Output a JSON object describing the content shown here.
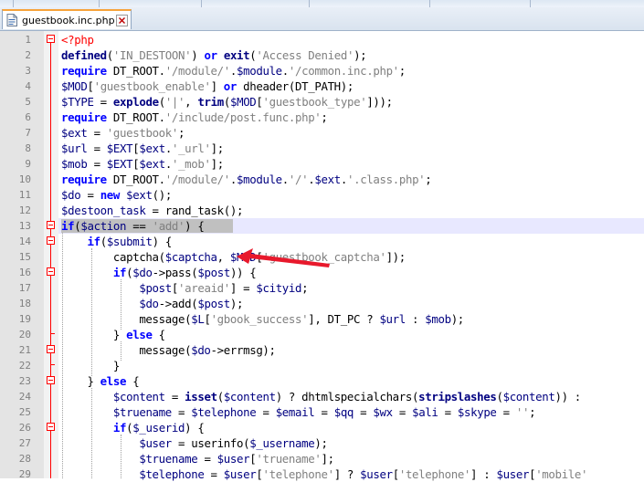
{
  "tab": {
    "filename": "guestbook.inc.php"
  },
  "editor": {
    "current_line": 13,
    "lines": [
      {
        "n": "1",
        "html": "<span class=\"php\">&lt;?php</span>"
      },
      {
        "n": "2",
        "html": "<span class=\"fn\">defined</span>(<span class=\"str\">'IN_DESTOON'</span>) <span class=\"kw\">or</span> <span class=\"fn\">exit</span>(<span class=\"str\">'Access Denied'</span>);"
      },
      {
        "n": "3",
        "html": "<span class=\"kw\">require</span> DT_ROOT.<span class=\"str\">'/module/'</span>.<span class=\"var\">$module</span>.<span class=\"str\">'/common.inc.php'</span>;"
      },
      {
        "n": "4",
        "html": "<span class=\"var\">$MOD</span>[<span class=\"str\">'guestbook_enable'</span>] <span class=\"kw\">or</span> dheader(DT_PATH);"
      },
      {
        "n": "5",
        "html": "<span class=\"var\">$TYPE</span> = <span class=\"fn\">explode</span>(<span class=\"str\">'|'</span>, <span class=\"fn\">trim</span>(<span class=\"var\">$MOD</span>[<span class=\"str\">'guestbook_type'</span>]));"
      },
      {
        "n": "6",
        "html": "<span class=\"kw\">require</span> DT_ROOT.<span class=\"str\">'/include/post.func.php'</span>;"
      },
      {
        "n": "7",
        "html": "<span class=\"var\">$ext</span> = <span class=\"str\">'guestbook'</span>;"
      },
      {
        "n": "8",
        "html": "<span class=\"var\">$url</span> = <span class=\"var\">$EXT</span>[<span class=\"var\">$ext</span>.<span class=\"str\">'_url'</span>];"
      },
      {
        "n": "9",
        "html": "<span class=\"var\">$mob</span> = <span class=\"var\">$EXT</span>[<span class=\"var\">$ext</span>.<span class=\"str\">'_mob'</span>];"
      },
      {
        "n": "10",
        "html": "<span class=\"kw\">require</span> DT_ROOT.<span class=\"str\">'/module/'</span>.<span class=\"var\">$module</span>.<span class=\"str\">'/'</span>.<span class=\"var\">$ext</span>.<span class=\"str\">'.class.php'</span>;"
      },
      {
        "n": "11",
        "html": "<span class=\"var\">$do</span> = <span class=\"kw\">new</span> <span class=\"var\">$ext</span>();"
      },
      {
        "n": "12",
        "html": "<span class=\"var\">$destoon_task</span> = rand_task();"
      },
      {
        "n": "13",
        "html": "<span class=\"kw\">if</span>(<span class=\"var\">$action</span> == <span class=\"str\">'add'</span>) {"
      },
      {
        "n": "14",
        "html": "    <span class=\"kw\">if</span>(<span class=\"var\">$submit</span>) {"
      },
      {
        "n": "15",
        "html": "        captcha(<span class=\"var\">$captcha</span>, <span class=\"var\">$MOD</span>[<span class=\"str\">'guestbook_captcha'</span>]);"
      },
      {
        "n": "16",
        "html": "        <span class=\"kw\">if</span>(<span class=\"var\">$do</span>-&gt;pass(<span class=\"var\">$post</span>)) {"
      },
      {
        "n": "17",
        "html": "            <span class=\"var\">$post</span>[<span class=\"str\">'areaid'</span>] = <span class=\"var\">$cityid</span>;"
      },
      {
        "n": "18",
        "html": "            <span class=\"var\">$do</span>-&gt;add(<span class=\"var\">$post</span>);"
      },
      {
        "n": "19",
        "html": "            message(<span class=\"var\">$L</span>[<span class=\"str\">'gbook_success'</span>], DT_PC ? <span class=\"var\">$url</span> : <span class=\"var\">$mob</span>);"
      },
      {
        "n": "20",
        "html": "        } <span class=\"kw\">else</span> {"
      },
      {
        "n": "21",
        "html": "            message(<span class=\"var\">$do</span>-&gt;errmsg);"
      },
      {
        "n": "22",
        "html": "        }"
      },
      {
        "n": "23",
        "html": "    } <span class=\"kw\">else</span> {"
      },
      {
        "n": "24",
        "html": "        <span class=\"var\">$content</span> = <span class=\"fn\">isset</span>(<span class=\"var\">$content</span>) ? dhtmlspecialchars(<span class=\"fn\">stripslashes</span>(<span class=\"var\">$content</span>)) :"
      },
      {
        "n": "25",
        "html": "        <span class=\"var\">$truename</span> = <span class=\"var\">$telephone</span> = <span class=\"var\">$email</span> = <span class=\"var\">$qq</span> = <span class=\"var\">$wx</span> = <span class=\"var\">$ali</span> = <span class=\"var\">$skype</span> = <span class=\"str\">''</span>;"
      },
      {
        "n": "26",
        "html": "        <span class=\"kw\">if</span>(<span class=\"var\">$_userid</span>) {"
      },
      {
        "n": "27",
        "html": "            <span class=\"var\">$user</span> = userinfo(<span class=\"var\">$_username</span>);"
      },
      {
        "n": "28",
        "html": "            <span class=\"var\">$truename</span> = <span class=\"var\">$user</span>[<span class=\"str\">'truename'</span>];"
      },
      {
        "n": "29",
        "html": "            <span class=\"var\">$telephone</span> = <span class=\"var\">$user</span>[<span class=\"str\">'telephone'</span>] ? <span class=\"var\">$user</span>[<span class=\"str\">'telephone'</span>] : <span class=\"var\">$user</span>[<span class=\"str\">'mobile'</span>"
      }
    ]
  }
}
